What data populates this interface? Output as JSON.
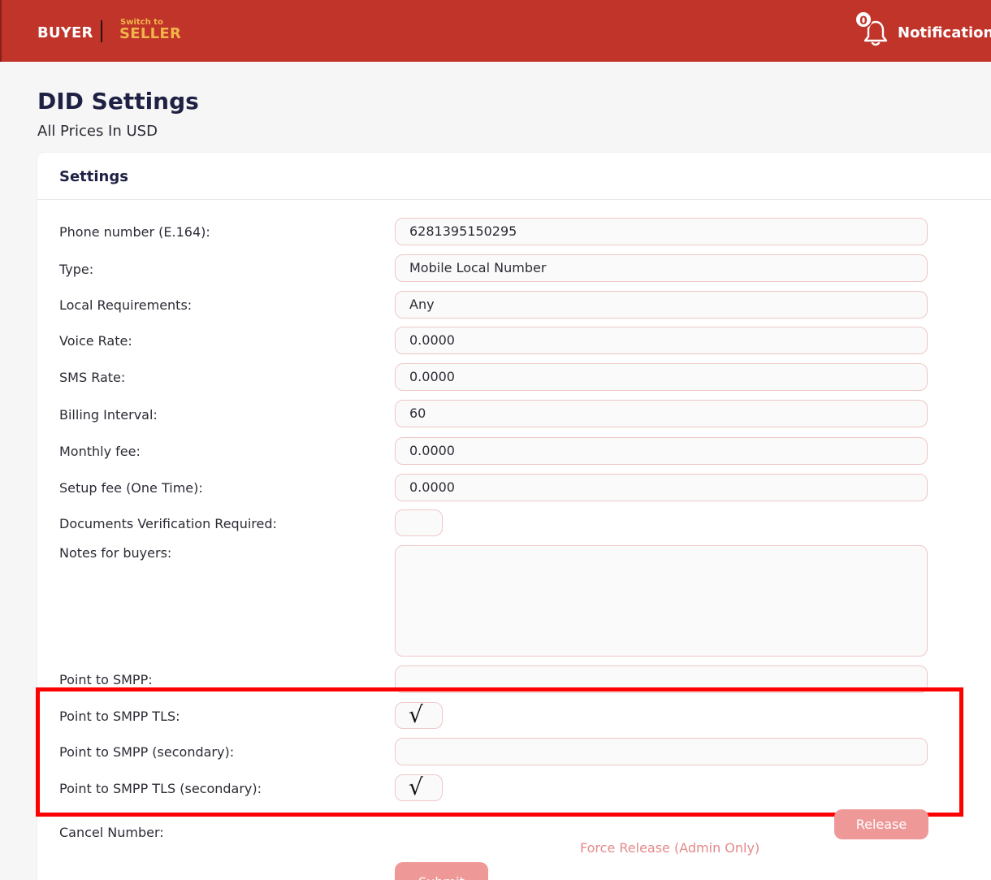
{
  "header": {
    "buyer_label": "BUYER",
    "switch_small": "Switch to",
    "switch_target": "SELLER",
    "notification_count": "0",
    "notifications_label": "Notifications"
  },
  "page": {
    "title": "DID Settings",
    "subtitle": "All Prices In USD"
  },
  "settings": {
    "title": "Settings",
    "phone_label": "Phone number (E.164):",
    "phone_value": "6281395150295",
    "type_label": "Type:",
    "type_value": "Mobile Local Number",
    "local_req_label": "Local Requirements:",
    "local_req_value": "Any",
    "voice_rate_label": "Voice Rate:",
    "voice_rate_value": "0.0000",
    "sms_rate_label": "SMS Rate:",
    "sms_rate_value": "0.0000",
    "billing_label": "Billing Interval:",
    "billing_value": "60",
    "monthly_label": "Monthly fee:",
    "monthly_value": "0.0000",
    "setup_label": "Setup fee (One Time):",
    "setup_value": "0.0000",
    "docs_label": "Documents Verification Required:",
    "docs_checked": "",
    "notes_label": "Notes for buyers:",
    "notes_value": "",
    "smpp_label": "Point to SMPP:",
    "smpp_value": "",
    "smpp_tls_label": "Point to SMPP TLS:",
    "smpp_tls_checked": "√",
    "smpp_secondary_label": "Point to SMPP (secondary):",
    "smpp_secondary_value": "",
    "smpp_tls_secondary_label": "Point to SMPP TLS (secondary):",
    "smpp_tls_secondary_checked": "√",
    "cancel_label": "Cancel Number:",
    "release_label": "Release",
    "force_release_label": "Force Release (Admin Only)",
    "submit_label": "Submit"
  },
  "colors": {
    "header_bg": "#c0342a",
    "accent_gold": "#f2b54a",
    "button_pink": "#ef9898",
    "highlight_red": "#ff0000"
  }
}
